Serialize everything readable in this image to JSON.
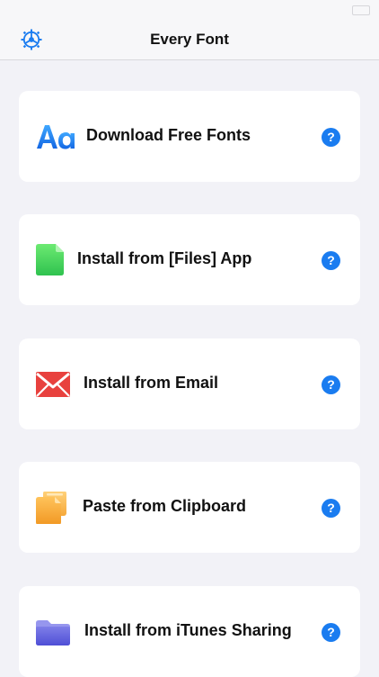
{
  "nav": {
    "title": "Every Font",
    "settings_icon": "gear-icon"
  },
  "actions": [
    {
      "label": "Download Free Fonts",
      "icon": "font-aa-icon",
      "help": "?"
    },
    {
      "label": "Install from [Files] App",
      "icon": "document-icon",
      "help": "?"
    },
    {
      "label": "Install from Email",
      "icon": "envelope-icon",
      "help": "?"
    },
    {
      "label": "Paste from Clipboard",
      "icon": "clipboard-icon",
      "help": "?"
    },
    {
      "label": "Install from iTunes Sharing",
      "icon": "folder-icon",
      "help": "?"
    }
  ],
  "colors": {
    "accent": "#1a7cf0",
    "background": "#f2f2f7",
    "card": "#ffffff"
  }
}
